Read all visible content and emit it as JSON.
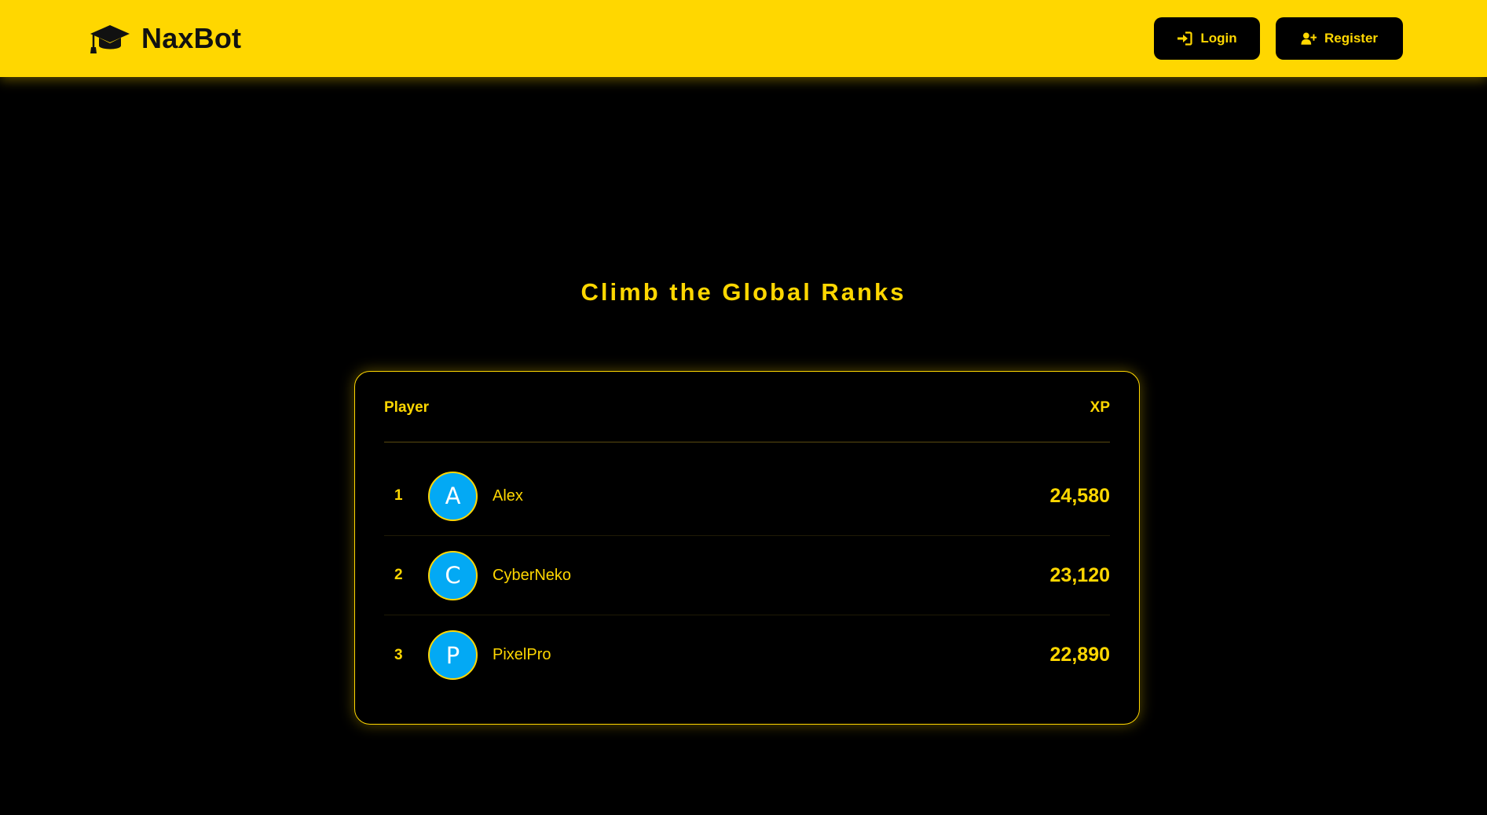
{
  "header": {
    "brand": "NaxBot",
    "brand_icon": "graduation-cap-icon",
    "login_label": "Login",
    "login_icon": "sign-in-icon",
    "register_label": "Register",
    "register_icon": "user-plus-icon"
  },
  "main": {
    "heading": "Climb the Global Ranks"
  },
  "leaderboard": {
    "col_player": "Player",
    "col_xp": "XP",
    "rows": [
      {
        "rank": "1",
        "initial": "A",
        "name": "Alex",
        "xp": "24,580"
      },
      {
        "rank": "2",
        "initial": "C",
        "name": "CyberNeko",
        "xp": "23,120"
      },
      {
        "rank": "3",
        "initial": "P",
        "name": "PixelPro",
        "xp": "22,890"
      }
    ]
  },
  "colors": {
    "accent": "#FFD700",
    "background": "#000000",
    "avatar": "#03A9F4"
  }
}
